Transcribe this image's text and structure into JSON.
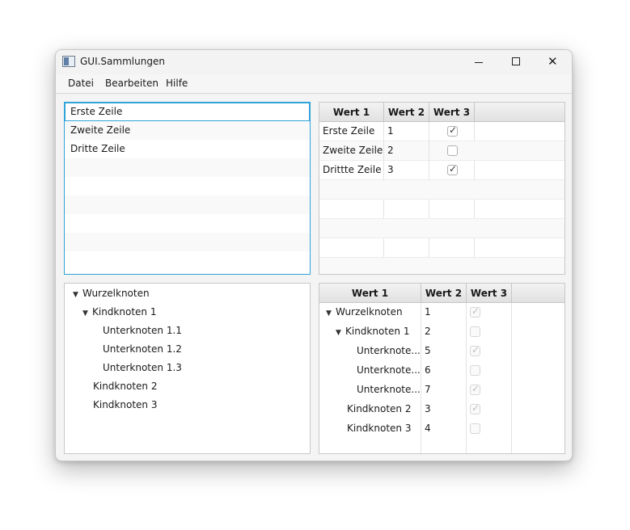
{
  "window": {
    "title": "GUI.Sammlungen"
  },
  "window_controls": {
    "minimize": "minimize",
    "maximize": "maximize",
    "close": "close"
  },
  "menu": [
    "Datei",
    "Bearbeiten",
    "Hilfe"
  ],
  "list": [
    "Erste Zeile",
    "Zweite Zeile",
    "Dritte Zeile"
  ],
  "table": {
    "columns": [
      "Wert 1",
      "Wert 2",
      "Wert 3"
    ],
    "rows": [
      {
        "c1": "Erste Zeile",
        "c2": "1",
        "c3": true
      },
      {
        "c1": "Zweite Zeile",
        "c2": "2",
        "c3": false
      },
      {
        "c1": "Drittte Zeile",
        "c2": "3",
        "c3": true
      }
    ]
  },
  "tree": {
    "nodes": [
      {
        "label": "Wurzelknoten",
        "expanded": true
      },
      {
        "label": "Kindknoten 1",
        "expanded": true
      },
      {
        "label": "Unterknoten 1.1"
      },
      {
        "label": "Unterknoten 1.2"
      },
      {
        "label": "Unterknoten 1.3"
      },
      {
        "label": "Kindknoten 2"
      },
      {
        "label": "Kindknoten 3"
      }
    ]
  },
  "treetable": {
    "columns": [
      "Wert 1",
      "Wert 2",
      "Wert 3"
    ],
    "rows": [
      {
        "label": "Wurzelknoten",
        "value": "1",
        "checked": true,
        "expanded": true
      },
      {
        "label": "Kindknoten 1",
        "value": "2",
        "checked": false,
        "expanded": true
      },
      {
        "label": "Unterknote...",
        "value": "5",
        "checked": true
      },
      {
        "label": "Unterknote...",
        "value": "6",
        "checked": false
      },
      {
        "label": "Unterknote...",
        "value": "7",
        "checked": true
      },
      {
        "label": "Kindknoten 2",
        "value": "3",
        "checked": true
      },
      {
        "label": "Kindknoten 3",
        "value": "4",
        "checked": false
      }
    ]
  },
  "colors": {
    "focus": "#30a3d8",
    "header": "#e6e6e6"
  }
}
